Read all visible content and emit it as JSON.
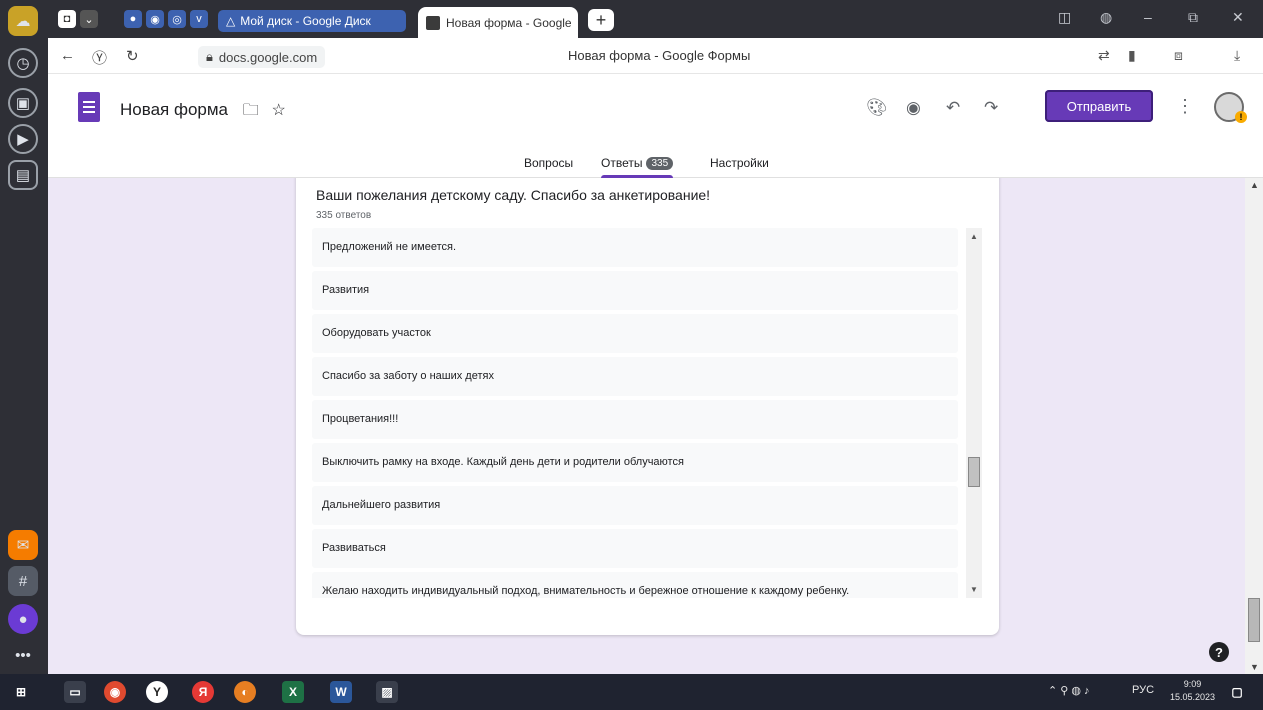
{
  "browser": {
    "tabs": [
      {
        "label": "Мой диск - Google Диск",
        "active": false
      },
      {
        "label": "Новая форма - Google",
        "active": true
      }
    ],
    "new_tab_icon": "+",
    "address": "docs.google.com",
    "page_title": "Новая форма - Google Формы"
  },
  "forms": {
    "form_name": "Новая форма",
    "send_label": "Отправить",
    "tabs": [
      {
        "label": "Вопросы"
      },
      {
        "label": "Ответы",
        "badge": "335"
      },
      {
        "label": "Настройки"
      }
    ],
    "accent_color": "#673ab7"
  },
  "question": {
    "title": "Ваши пожелания детскому саду. Спасибо за анкетирование!",
    "count": "335 ответов",
    "answers": [
      "Предложений не имеется.",
      "Развития",
      "Оборудовать участок",
      "Спасибо за заботу о наших детях",
      "Процветания!!!",
      "Выключить рамку на входе. Каждый день дети и родители облучаются",
      "Дальнейшего развития",
      "Развиваться",
      "Желаю находить индивидуальный подход, внимательность и бережное отношение к каждому ребенку."
    ]
  },
  "taskbar": {
    "lang": "РУС",
    "time": "9:09",
    "date": "15.05.2023"
  }
}
